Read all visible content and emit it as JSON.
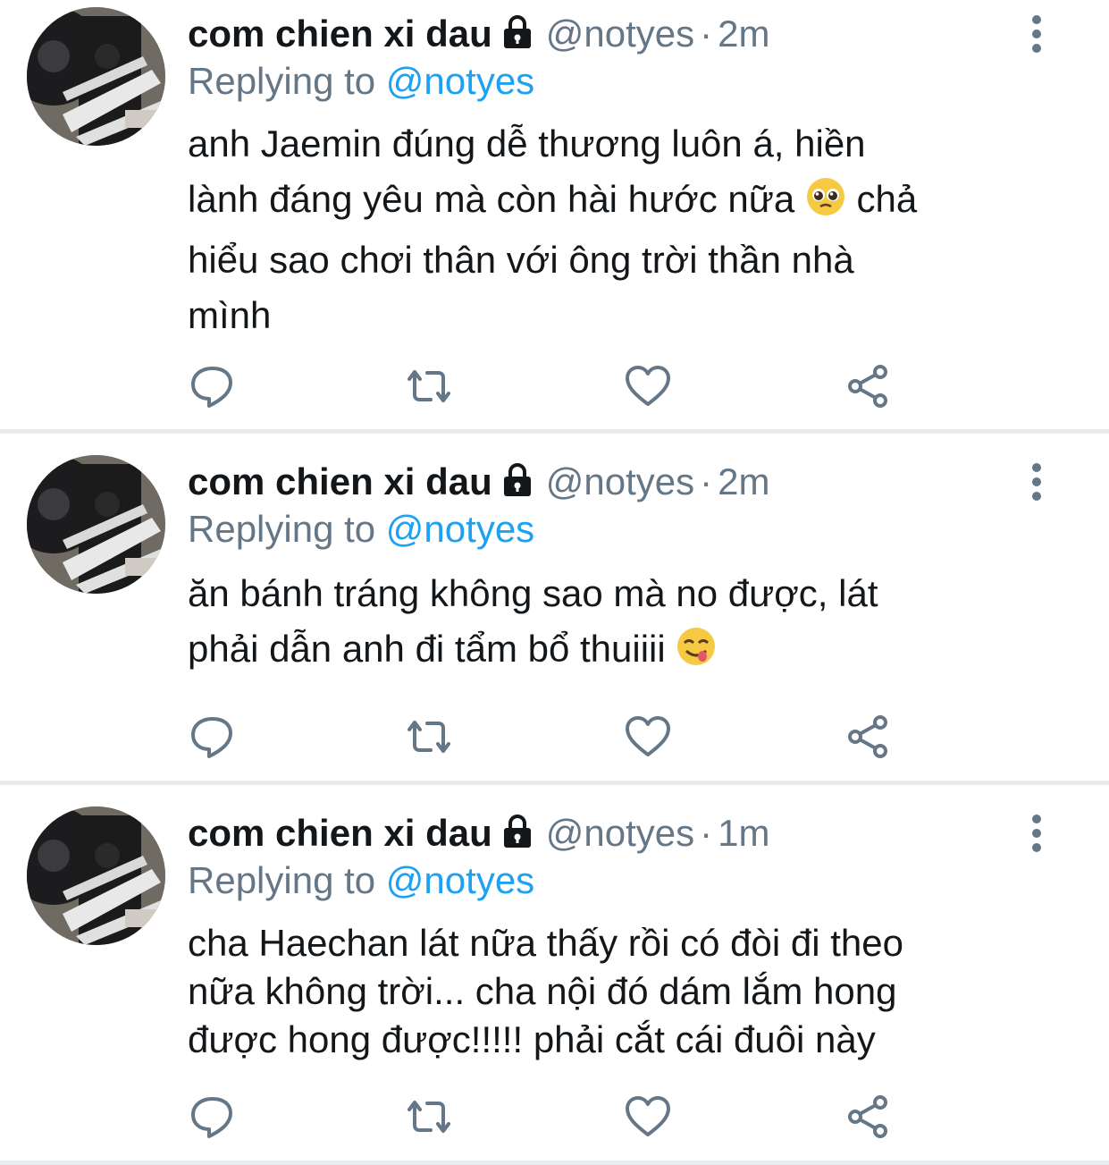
{
  "tweets": [
    {
      "name": "com chien xi dau",
      "handle": "@notyes",
      "separator": "·",
      "time": "2m",
      "replying_prefix": "Replying to",
      "replying_to": "@notyes",
      "lines": [
        "anh Jaemin đúng dễ thương luôn á, hiền",
        "lành đáng yêu mà còn hài hước nữa",
        "chả",
        "hiểu sao chơi thân với ông trời thần nhà",
        "mình"
      ],
      "emoji": "pleading-face"
    },
    {
      "name": "com chien xi dau",
      "handle": "@notyes",
      "separator": "·",
      "time": "2m",
      "replying_prefix": "Replying to",
      "replying_to": "@notyes",
      "lines": [
        "ăn bánh tráng không sao mà no được, lát",
        "phải dẫn anh đi tẩm bổ thuiiii"
      ],
      "emoji": "face-savoring-food"
    },
    {
      "name": "com chien xi dau",
      "handle": "@notyes",
      "separator": "·",
      "time": "1m",
      "replying_prefix": "Replying to",
      "replying_to": "@notyes",
      "lines": [
        "cha Haechan lát nữa thấy rồi có đòi đi theo",
        "nữa không trời... cha nội đó dám lắm hong",
        "được hong được!!!!! phải cắt cái đuôi này"
      ]
    }
  ],
  "icons": {
    "reply": "reply-icon",
    "retweet": "retweet-icon",
    "like": "heart-icon",
    "share": "share-icon",
    "more": "more-options-icon",
    "lock": "lock-icon"
  },
  "colors": {
    "name": "#14171a",
    "secondary": "#657786",
    "mention": "#1da1f2",
    "divider": "#e9ecef",
    "icon": "#657786"
  }
}
